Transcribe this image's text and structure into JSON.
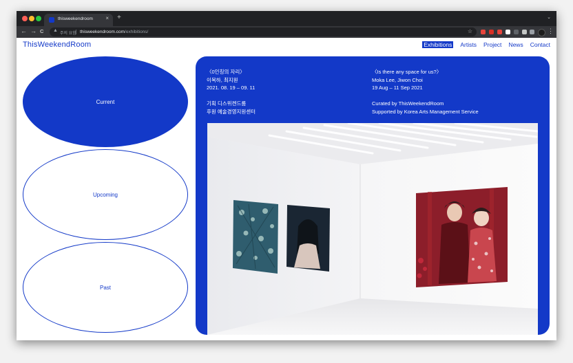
{
  "browser": {
    "tab_title": "thisweekendroom",
    "tab_close": "×",
    "new_tab": "+",
    "tab_menu": "⌄",
    "back": "←",
    "forward": "→",
    "reload": "C",
    "security_warning": "주의 요함",
    "url_host": "thisweekendroom.com",
    "url_path": "/exhibitions/",
    "menu": "⋮",
    "extension_colors": [
      "#e8453c",
      "#d93025",
      "#e8453c",
      "#ffffff",
      "#5f6368",
      "#c4c7c5"
    ]
  },
  "site": {
    "logo": "ThisWeekendRoom",
    "nav": [
      {
        "label": "Exhibitions",
        "active": true
      },
      {
        "label": "Artists",
        "active": false
      },
      {
        "label": "Project",
        "active": false
      },
      {
        "label": "News",
        "active": false
      },
      {
        "label": "Contact",
        "active": false
      }
    ]
  },
  "filters": [
    {
      "label": "Current",
      "selected": true
    },
    {
      "label": "Upcoming",
      "selected": false
    },
    {
      "label": "Past",
      "selected": false
    }
  ],
  "exhibition": {
    "ko": {
      "title": "〈0인칭의 자리〉",
      "artists": "이목하, 최지원",
      "dates": "2021. 08. 19 – 09. 11",
      "curated": "기획 디스위켄드룸",
      "supported": "후원 예술경영지원센터"
    },
    "en": {
      "title": "〈Is there any space for us?〉",
      "artists": "Moka Lee, Jiwon Choi",
      "dates": "19 Aug – 11 Sep 2021",
      "curated": "Curated by ThisWeekendRoom",
      "supported": "Supported by Korea Arts Management Service"
    }
  },
  "colors": {
    "accent": "#1339c8",
    "chrome_dark": "#202124",
    "chrome_toolbar": "#35363a"
  },
  "icons": [
    "star-icon",
    "warning-icon",
    "puzzle-icon",
    "profile-icon"
  ]
}
